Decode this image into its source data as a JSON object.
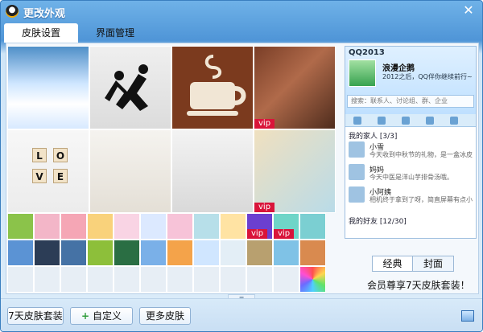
{
  "window": {
    "title": "更改外观",
    "close_icon": "close-icon"
  },
  "tabs": [
    {
      "label": "皮肤设置"
    },
    {
      "label": "界面管理"
    }
  ],
  "skins": {
    "vip_label": "vip",
    "love_tiles": [
      "L",
      "O",
      "V",
      "E"
    ]
  },
  "preview": {
    "title": "QQ2013",
    "user_name": "浪漫企鹅",
    "signature": "2012之后，QQ伴你继续前行~",
    "search_placeholder": "搜索：联系人、讨论组、群、企业",
    "groups": [
      {
        "label": "我的家人 [3/3]"
      },
      {
        "label": "我的好友 [12/30]"
      }
    ],
    "contacts": [
      {
        "name": "小雪",
        "desc": "今天收到中秋节的礼物，是一盒冰皮月饼"
      },
      {
        "name": "妈妈",
        "desc": "今天中医是洋山芋排骨汤哦。"
      },
      {
        "name": "小阿姨",
        "desc": "相机终于拿到了呀，简直屏幕有点小。"
      }
    ]
  },
  "mode": {
    "selected": "经典",
    "other": "封面"
  },
  "promo": "会员尊享7天皮肤套装！",
  "bottom_buttons": {
    "seven_day": "7天皮肤套装",
    "custom": "自定义",
    "more": "更多皮肤"
  },
  "footer_icon": "skin-box-icon"
}
